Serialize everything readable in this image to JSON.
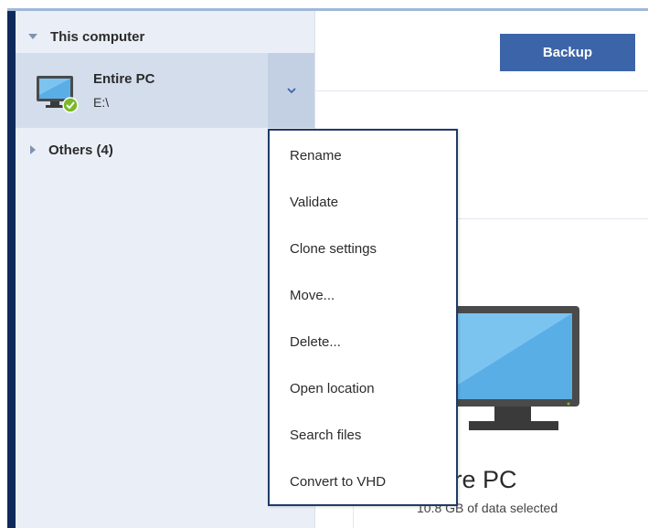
{
  "sidebar": {
    "section_this_computer": "This computer",
    "backup_item": {
      "title": "Entire PC",
      "subtitle": "E:\\",
      "status_icon": "check-icon"
    },
    "section_others": "Others (4)"
  },
  "main": {
    "backup_button": "Backup",
    "backup_name": "Entire PC",
    "backup_size": "10.8 GB of data selected"
  },
  "context_menu": {
    "items": [
      "Rename",
      "Validate",
      "Clone settings",
      "Move...",
      "Delete...",
      "Open location",
      "Search files",
      "Convert to VHD"
    ]
  },
  "colors": {
    "accent_dark": "#0e2a5c",
    "sidebar_bg": "#eaeff7",
    "selected_row": "#d3ddec",
    "button_blue": "#3c64a8",
    "status_green": "#7ab929"
  }
}
